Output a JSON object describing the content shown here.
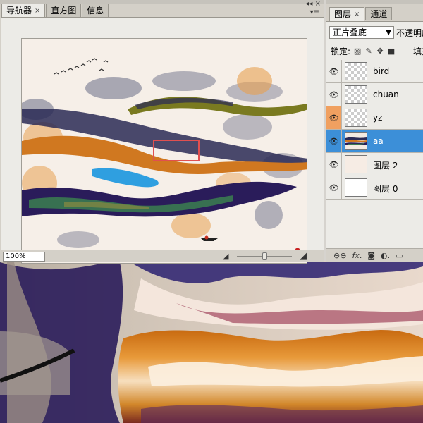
{
  "navigator": {
    "tabs": [
      {
        "label": "导航器",
        "close": "×"
      },
      {
        "label": "直方图"
      },
      {
        "label": "信息"
      }
    ],
    "zoom_value": "100%",
    "collapse_glyph": "◂◂",
    "close_glyph": "×",
    "menu_glyph": "▾≡"
  },
  "layers": {
    "tabs": [
      {
        "label": "图层",
        "close": "×"
      },
      {
        "label": "通道"
      }
    ],
    "blend_mode": "正片叠底",
    "opacity_label": "不透明度",
    "lock_label": "锁定:",
    "fill_label": "填充",
    "items": [
      {
        "name": "bird",
        "thumb": "transparent",
        "eye_highlight": false,
        "selected": false
      },
      {
        "name": "chuan",
        "thumb": "transparent",
        "eye_highlight": false,
        "selected": false
      },
      {
        "name": "yz",
        "thumb": "transparent",
        "eye_highlight": true,
        "selected": false
      },
      {
        "name": "aa",
        "thumb": "painting",
        "eye_highlight": false,
        "selected": true
      },
      {
        "name": "图层 2",
        "thumb": "paper",
        "eye_highlight": false,
        "selected": false
      },
      {
        "name": "图层 0",
        "thumb": "white",
        "eye_highlight": false,
        "selected": false
      }
    ],
    "footer_icons": [
      "link-icon",
      "fx-icon",
      "mask-icon",
      "adjustment-icon",
      "folder-icon"
    ]
  },
  "colors": {
    "selection_blue": "#3c8fd8",
    "eye_highlight_orange": "#f0a060",
    "view_box_red": "#e05050",
    "panel_gray": "#d4d0c8"
  }
}
